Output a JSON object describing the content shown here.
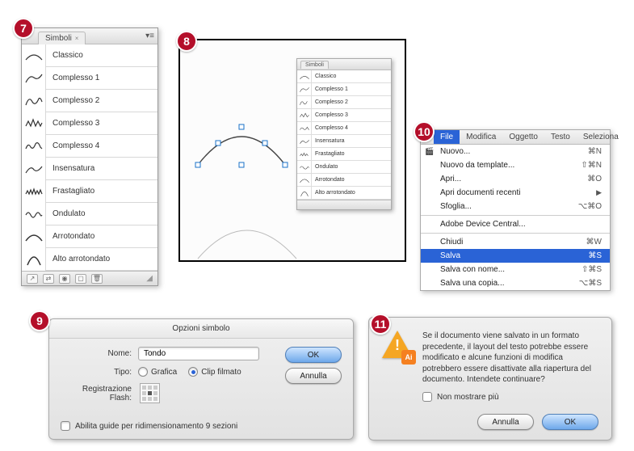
{
  "badges": {
    "b7": "7",
    "b8": "8",
    "b9": "9",
    "b10": "10",
    "b11": "11"
  },
  "symbols_panel": {
    "title": "Simboli",
    "items": [
      "Classico",
      "Complesso 1",
      "Complesso 2",
      "Complesso 3",
      "Complesso 4",
      "Insensatura",
      "Frastagliato",
      "Ondulato",
      "Arrotondato",
      "Alto arrotondato"
    ]
  },
  "file_menu": {
    "menubar": [
      "File",
      "Modifica",
      "Oggetto",
      "Testo",
      "Seleziona"
    ],
    "items": [
      {
        "label": "Nuovo...",
        "shortcut": "⌘N"
      },
      {
        "label": "Nuovo da template...",
        "shortcut": "⇧⌘N"
      },
      {
        "label": "Apri...",
        "shortcut": "⌘O"
      },
      {
        "label": "Apri documenti recenti",
        "shortcut": "",
        "arrow": true
      },
      {
        "label": "Sfoglia...",
        "shortcut": "⌥⌘O"
      },
      {
        "sep": true
      },
      {
        "label": "Adobe Device Central...",
        "shortcut": ""
      },
      {
        "sep": true
      },
      {
        "label": "Chiudi",
        "shortcut": "⌘W"
      },
      {
        "label": "Salva",
        "shortcut": "⌘S",
        "selected": true
      },
      {
        "label": "Salva con nome...",
        "shortcut": "⇧⌘S"
      },
      {
        "label": "Salva una copia...",
        "shortcut": "⌥⌘S"
      }
    ]
  },
  "options_dialog": {
    "title": "Opzioni simbolo",
    "name_label": "Nome:",
    "name_value": "Tondo",
    "type_label": "Tipo:",
    "type_graphic": "Grafica",
    "type_clip": "Clip filmato",
    "flash_label": "Registrazione Flash:",
    "guides_label": "Abilita guide per ridimensionamento 9 sezioni",
    "ok": "OK",
    "cancel": "Annulla"
  },
  "warning_dialog": {
    "message": "Se il documento viene salvato in un formato precedente, il layout del testo potrebbe essere modificato e alcune funzioni di modifica potrebbero essere disattivate alla riapertura del documento. Intendete continuare?",
    "dont_show": "Non mostrare più",
    "cancel": "Annulla",
    "ok": "OK",
    "ai": "Ai"
  }
}
